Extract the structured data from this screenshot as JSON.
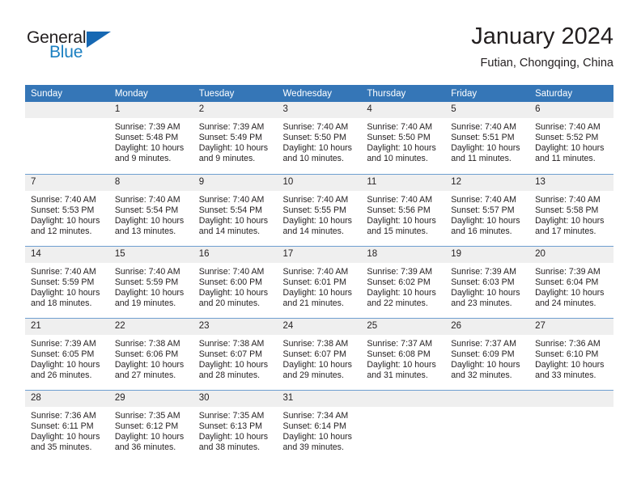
{
  "logo": {
    "word_top": "General",
    "word_bottom": "Blue",
    "triangle_color": "#1668b3"
  },
  "header": {
    "title": "January 2024",
    "location": "Futian, Chongqing, China"
  },
  "theme": {
    "header_blue": "#3576b7",
    "row_divider": "#6f9fd0",
    "daynum_band": "#efefef"
  },
  "calendar": {
    "weekday_headers": [
      "Sunday",
      "Monday",
      "Tuesday",
      "Wednesday",
      "Thursday",
      "Friday",
      "Saturday"
    ],
    "weeks": [
      [
        {
          "day": "",
          "details": ""
        },
        {
          "day": "1",
          "details": "Sunrise: 7:39 AM\nSunset: 5:48 PM\nDaylight: 10 hours and 9 minutes."
        },
        {
          "day": "2",
          "details": "Sunrise: 7:39 AM\nSunset: 5:49 PM\nDaylight: 10 hours and 9 minutes."
        },
        {
          "day": "3",
          "details": "Sunrise: 7:40 AM\nSunset: 5:50 PM\nDaylight: 10 hours and 10 minutes."
        },
        {
          "day": "4",
          "details": "Sunrise: 7:40 AM\nSunset: 5:50 PM\nDaylight: 10 hours and 10 minutes."
        },
        {
          "day": "5",
          "details": "Sunrise: 7:40 AM\nSunset: 5:51 PM\nDaylight: 10 hours and 11 minutes."
        },
        {
          "day": "6",
          "details": "Sunrise: 7:40 AM\nSunset: 5:52 PM\nDaylight: 10 hours and 11 minutes."
        }
      ],
      [
        {
          "day": "7",
          "details": "Sunrise: 7:40 AM\nSunset: 5:53 PM\nDaylight: 10 hours and 12 minutes."
        },
        {
          "day": "8",
          "details": "Sunrise: 7:40 AM\nSunset: 5:54 PM\nDaylight: 10 hours and 13 minutes."
        },
        {
          "day": "9",
          "details": "Sunrise: 7:40 AM\nSunset: 5:54 PM\nDaylight: 10 hours and 14 minutes."
        },
        {
          "day": "10",
          "details": "Sunrise: 7:40 AM\nSunset: 5:55 PM\nDaylight: 10 hours and 14 minutes."
        },
        {
          "day": "11",
          "details": "Sunrise: 7:40 AM\nSunset: 5:56 PM\nDaylight: 10 hours and 15 minutes."
        },
        {
          "day": "12",
          "details": "Sunrise: 7:40 AM\nSunset: 5:57 PM\nDaylight: 10 hours and 16 minutes."
        },
        {
          "day": "13",
          "details": "Sunrise: 7:40 AM\nSunset: 5:58 PM\nDaylight: 10 hours and 17 minutes."
        }
      ],
      [
        {
          "day": "14",
          "details": "Sunrise: 7:40 AM\nSunset: 5:59 PM\nDaylight: 10 hours and 18 minutes."
        },
        {
          "day": "15",
          "details": "Sunrise: 7:40 AM\nSunset: 5:59 PM\nDaylight: 10 hours and 19 minutes."
        },
        {
          "day": "16",
          "details": "Sunrise: 7:40 AM\nSunset: 6:00 PM\nDaylight: 10 hours and 20 minutes."
        },
        {
          "day": "17",
          "details": "Sunrise: 7:40 AM\nSunset: 6:01 PM\nDaylight: 10 hours and 21 minutes."
        },
        {
          "day": "18",
          "details": "Sunrise: 7:39 AM\nSunset: 6:02 PM\nDaylight: 10 hours and 22 minutes."
        },
        {
          "day": "19",
          "details": "Sunrise: 7:39 AM\nSunset: 6:03 PM\nDaylight: 10 hours and 23 minutes."
        },
        {
          "day": "20",
          "details": "Sunrise: 7:39 AM\nSunset: 6:04 PM\nDaylight: 10 hours and 24 minutes."
        }
      ],
      [
        {
          "day": "21",
          "details": "Sunrise: 7:39 AM\nSunset: 6:05 PM\nDaylight: 10 hours and 26 minutes."
        },
        {
          "day": "22",
          "details": "Sunrise: 7:38 AM\nSunset: 6:06 PM\nDaylight: 10 hours and 27 minutes."
        },
        {
          "day": "23",
          "details": "Sunrise: 7:38 AM\nSunset: 6:07 PM\nDaylight: 10 hours and 28 minutes."
        },
        {
          "day": "24",
          "details": "Sunrise: 7:38 AM\nSunset: 6:07 PM\nDaylight: 10 hours and 29 minutes."
        },
        {
          "day": "25",
          "details": "Sunrise: 7:37 AM\nSunset: 6:08 PM\nDaylight: 10 hours and 31 minutes."
        },
        {
          "day": "26",
          "details": "Sunrise: 7:37 AM\nSunset: 6:09 PM\nDaylight: 10 hours and 32 minutes."
        },
        {
          "day": "27",
          "details": "Sunrise: 7:36 AM\nSunset: 6:10 PM\nDaylight: 10 hours and 33 minutes."
        }
      ],
      [
        {
          "day": "28",
          "details": "Sunrise: 7:36 AM\nSunset: 6:11 PM\nDaylight: 10 hours and 35 minutes."
        },
        {
          "day": "29",
          "details": "Sunrise: 7:35 AM\nSunset: 6:12 PM\nDaylight: 10 hours and 36 minutes."
        },
        {
          "day": "30",
          "details": "Sunrise: 7:35 AM\nSunset: 6:13 PM\nDaylight: 10 hours and 38 minutes."
        },
        {
          "day": "31",
          "details": "Sunrise: 7:34 AM\nSunset: 6:14 PM\nDaylight: 10 hours and 39 minutes."
        },
        {
          "day": "",
          "details": ""
        },
        {
          "day": "",
          "details": ""
        },
        {
          "day": "",
          "details": ""
        }
      ]
    ]
  }
}
